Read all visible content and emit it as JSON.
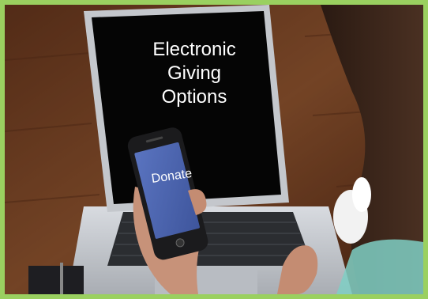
{
  "photo": {
    "screen_lines": [
      "Electronic",
      "Giving",
      "Options"
    ],
    "phone_label": "Donate"
  },
  "colors": {
    "border": "#9ad060",
    "table": "#8a4a2a",
    "laptop": "#c9ccd1",
    "screen": "#050505",
    "phone_screen": "#4d67b2"
  }
}
